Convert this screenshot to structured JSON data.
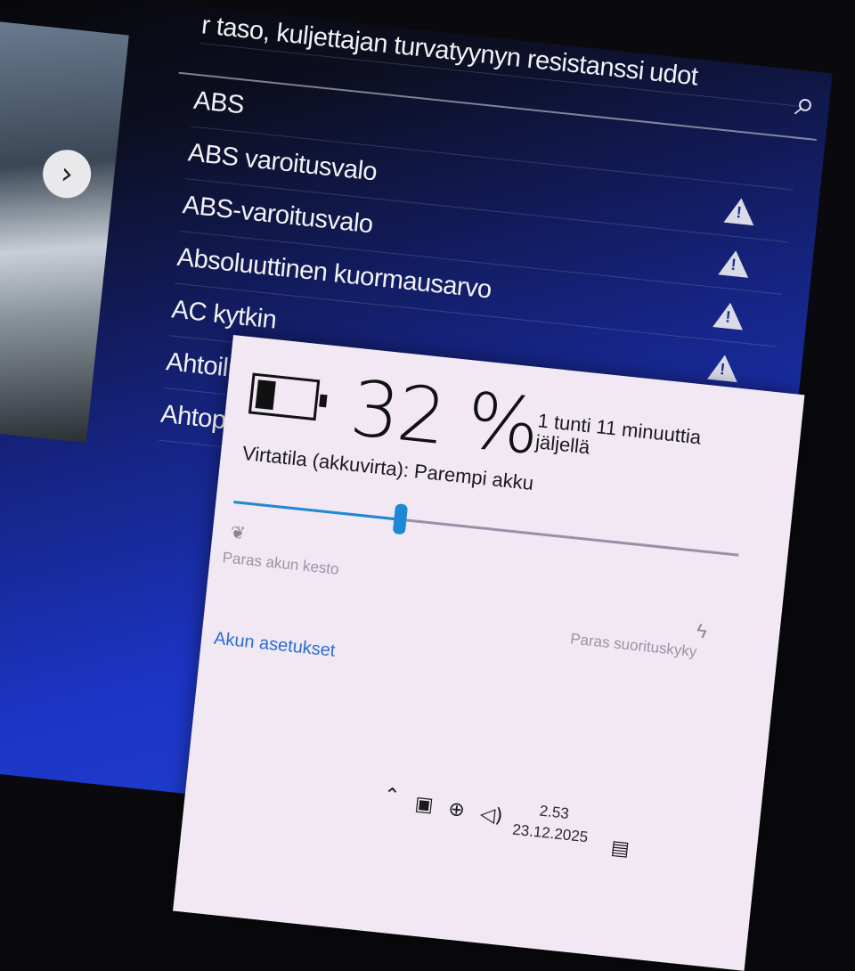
{
  "list": {
    "header_partial": "r taso, kuljettajan turvatyynyn resistanssi",
    "header_right_partial": "udot",
    "items": [
      {
        "label": "ABS",
        "warn": false
      },
      {
        "label": "ABS varoitusvalo",
        "warn": true
      },
      {
        "label": "ABS-varoitusvalo",
        "warn": true
      },
      {
        "label": "Absoluuttinen kuormausarvo",
        "warn": true
      },
      {
        "label": "AC kytkin",
        "warn": true
      },
      {
        "label": "Ahtoilman jäähdytys lämpöanturi",
        "warn": true
      },
      {
        "label": "Ahtopai",
        "warn": true
      }
    ],
    "nav_arrow": "›"
  },
  "battery": {
    "percent_text": "32 %",
    "level": 0.32,
    "remaining_text": "1 tunti 11 minuuttia jäljellä",
    "mode_label": "Virtatila (akkuvirta): Parempi akku",
    "slider_value": 0.33,
    "label_left": "Paras akun kesto",
    "label_right": "Paras suorituskyky",
    "settings_link": "Akun asetukset"
  },
  "tray": {
    "time": "2.53",
    "date": "23.12.2025",
    "icons": [
      "chevron-up-icon",
      "battery-plug-icon",
      "globe-icon",
      "speaker-icon",
      "notification-icon"
    ]
  },
  "colors": {
    "accent": "#1e88d4",
    "flyout_bg": "#f1e8f4",
    "link": "#2a6dd0"
  }
}
